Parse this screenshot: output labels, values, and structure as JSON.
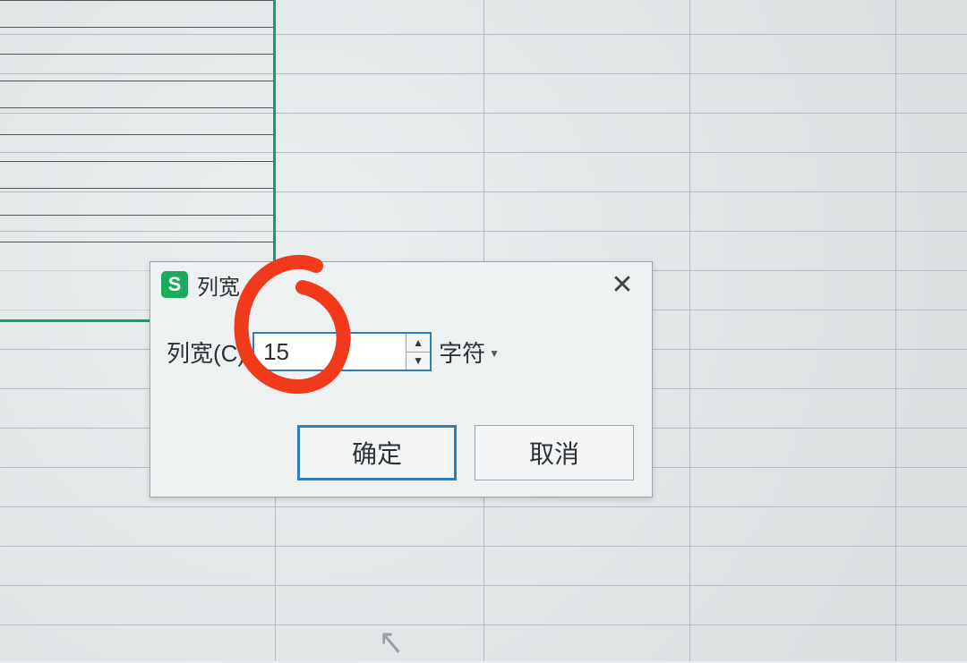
{
  "dialog": {
    "title": "列宽",
    "field_label": "列宽(C)",
    "value": "15",
    "unit_label": "字符",
    "ok_label": "确定",
    "cancel_label": "取消"
  }
}
